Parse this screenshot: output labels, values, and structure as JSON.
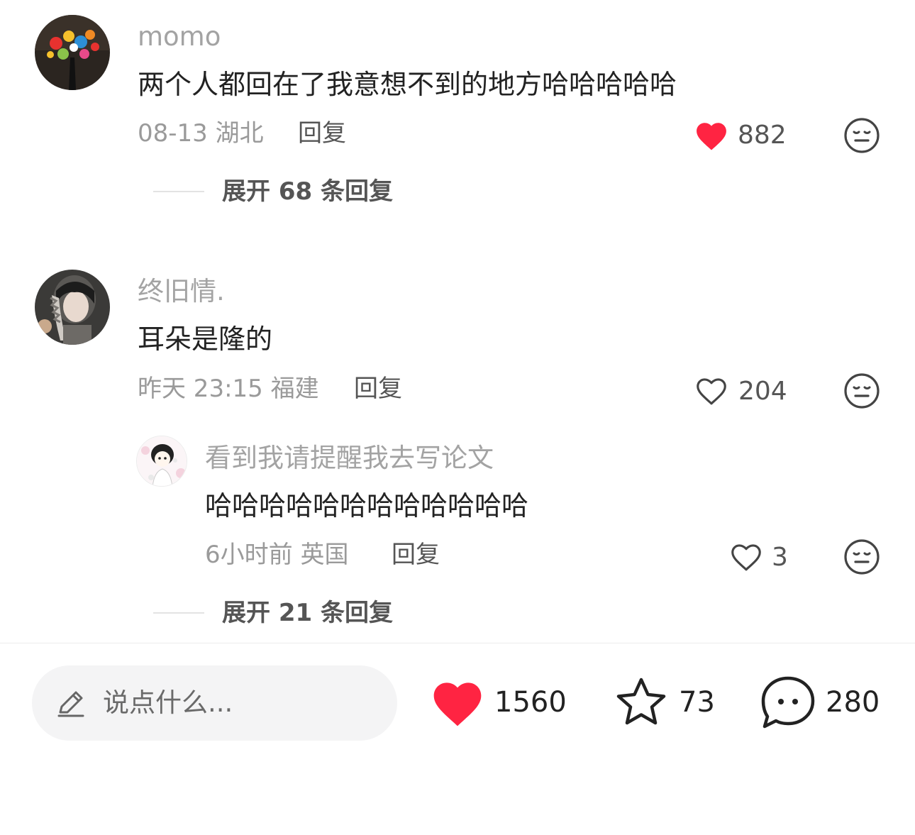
{
  "comments": [
    {
      "username": "momo",
      "text": "两个人都回在了我意想不到的地方哈哈哈哈哈",
      "meta": "08-13 湖北",
      "reply_label": "回复",
      "likes": "882",
      "liked": true,
      "avatar_icon": "flower-bouquet-avatar",
      "expand_label": "展开 68 条回复"
    },
    {
      "username": "终旧情.",
      "text": "耳朵是隆的",
      "meta": "昨天 23:15 福建",
      "reply_label": "回复",
      "likes": "204",
      "liked": false,
      "avatar_icon": "girl-photo-avatar",
      "replies": [
        {
          "username": "看到我请提醒我去写论文",
          "text": "哈哈哈哈哈哈哈哈哈哈哈哈",
          "meta": "6小时前 英国",
          "reply_label": "回复",
          "likes": "3",
          "liked": false,
          "avatar_icon": "cartoon-girl-avatar"
        }
      ],
      "expand_label": "展开 21 条回复"
    }
  ],
  "bottom_bar": {
    "input_placeholder": "说点什么...",
    "likes": "1560",
    "favorites": "73",
    "comments": "280"
  },
  "colors": {
    "like_red": "#ff2442",
    "muted_text": "#9a9a9a",
    "body_text": "#222222"
  }
}
